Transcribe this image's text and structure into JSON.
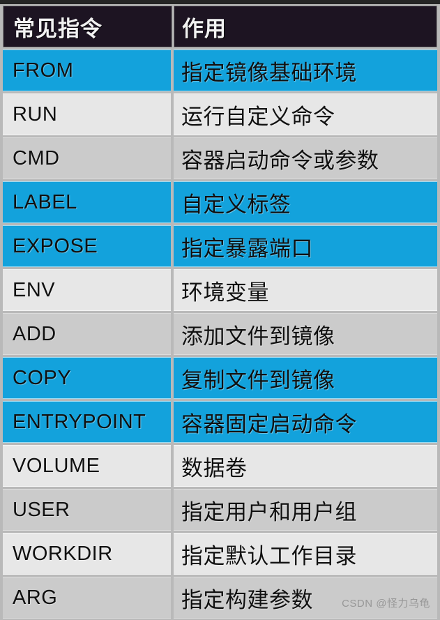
{
  "table": {
    "headers": {
      "command": "常见指令",
      "description": "作用"
    },
    "rows": [
      {
        "command": "FROM",
        "description": "指定镜像基础环境",
        "style": "blue"
      },
      {
        "command": "RUN",
        "description": "运行自定义命令",
        "style": "light"
      },
      {
        "command": "CMD",
        "description": "容器启动命令或参数",
        "style": "dark"
      },
      {
        "command": "LABEL",
        "description": "自定义标签",
        "style": "blue"
      },
      {
        "command": "EXPOSE",
        "description": "指定暴露端口",
        "style": "blue"
      },
      {
        "command": "ENV",
        "description": "环境变量",
        "style": "light"
      },
      {
        "command": "ADD",
        "description": "添加文件到镜像",
        "style": "dark"
      },
      {
        "command": "COPY",
        "description": "复制文件到镜像",
        "style": "blue"
      },
      {
        "command": "ENTRYPOINT",
        "description": "容器固定启动命令",
        "style": "blue"
      },
      {
        "command": "VOLUME",
        "description": "数据卷",
        "style": "light"
      },
      {
        "command": "USER",
        "description": "指定用户和用户组",
        "style": "dark"
      },
      {
        "command": "WORKDIR",
        "description": "指定默认工作目录",
        "style": "light"
      },
      {
        "command": "ARG",
        "description": "指定构建参数",
        "style": "dark"
      }
    ]
  },
  "watermark": {
    "text": "CSDN @怪力乌龟"
  },
  "colors": {
    "highlight": "#13a2dc",
    "row_light": "#e7e7e7",
    "row_dark": "#cbcbcb",
    "header_bg": "#1d1422",
    "header_text": "#f2f2f2",
    "body_text": "#101010"
  }
}
